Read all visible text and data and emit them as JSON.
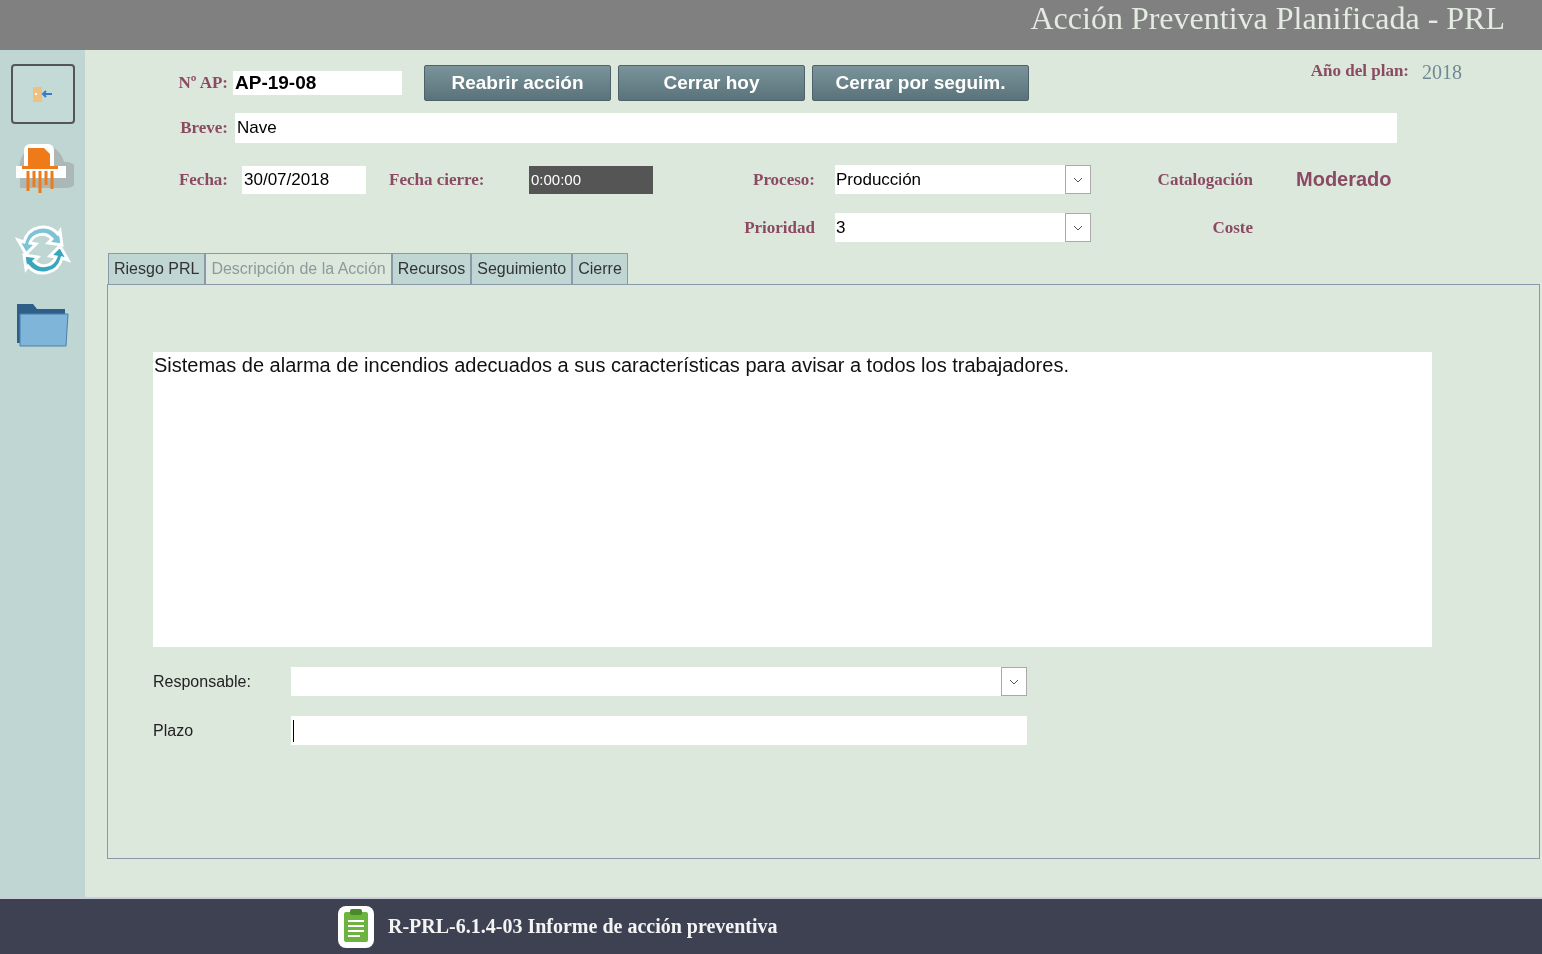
{
  "window": {
    "title": "Acción Preventiva Planificada - PRL"
  },
  "record": {
    "number": {
      "label": "Nº AP:",
      "value": "AP-19-08"
    },
    "year": {
      "label": "Año del plan:",
      "value": "2018"
    },
    "brief": {
      "label": "Breve:",
      "value": "Nave"
    },
    "date": {
      "label": "Fecha:",
      "value": "30/07/2018"
    },
    "close_date": {
      "label": "Fecha cierre:",
      "value": "0:00:00"
    },
    "process": {
      "label": "Proceso:",
      "value": "Producción"
    },
    "cataloging": {
      "label": "Catalogación",
      "value": "Moderado"
    },
    "priority": {
      "label": "Prioridad",
      "value": "3"
    },
    "cost": {
      "label": "Coste"
    }
  },
  "buttons": [
    "Reabrir acción",
    "Cerrar hoy",
    "Cerrar por seguim."
  ],
  "tabs": [
    {
      "label": "Riesgo PRL",
      "selected": false
    },
    {
      "label": "Descripción de la Acción",
      "selected": true
    },
    {
      "label": "Recursos",
      "selected": false
    },
    {
      "label": "Seguimiento",
      "selected": false
    },
    {
      "label": "Cierre",
      "selected": false
    }
  ],
  "description": "Sistemas de alarma de incendios adecuados a sus características para avisar a todos los trabajadores.",
  "responsable": {
    "label": "Responsable:"
  },
  "deadline": {
    "label": "Plazo",
    "focused": true
  },
  "status_bar": {
    "report": "R-PRL-6.1.4-03 Informe de acción preventiva"
  }
}
